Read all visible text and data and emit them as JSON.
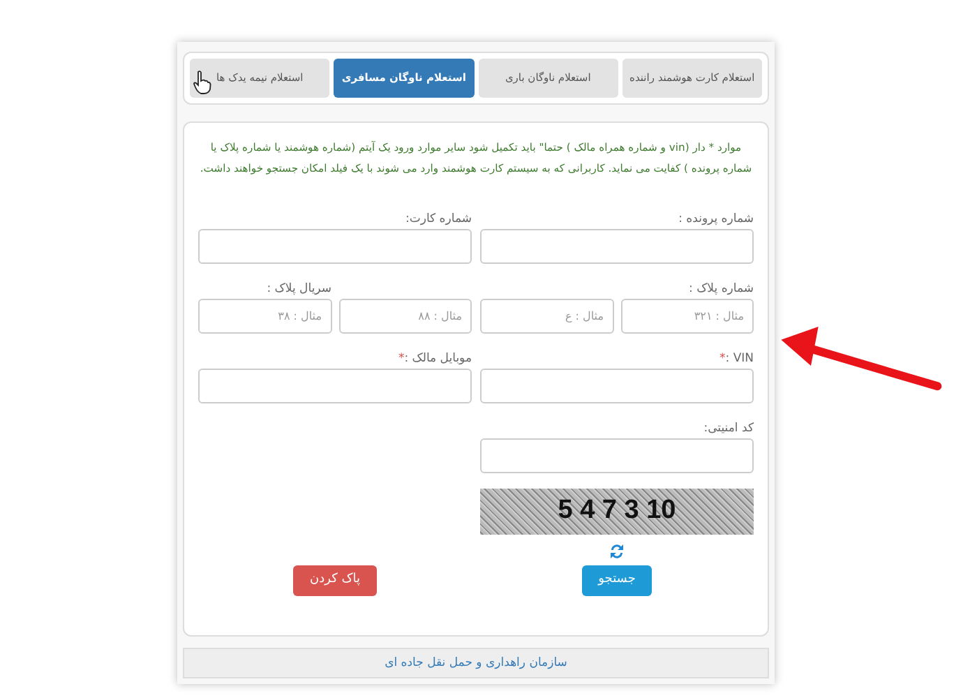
{
  "tabs": [
    {
      "label": "استعلام کارت هوشمند راننده",
      "selected": false
    },
    {
      "label": "استعلام ناوگان باری",
      "selected": false
    },
    {
      "label": "استعلام ناوگان مسافری",
      "selected": true
    },
    {
      "label": "استعلام نیمه یدک ها",
      "selected": false
    }
  ],
  "notice": "موارد * دار (vin و شماره همراه مالک ) حتما\" باید تکمیل شود سایر موارد ورود یک آیتم (شماره هوشمند یا شماره پلاک یا شماره پرونده ) کفایت می نماید. کاربرانی که به سیستم کارت هوشمند وارد می شوند با یک فیلد امکان جستجو خواهند داشت.",
  "rows": [
    {
      "kind": "pair",
      "fields": [
        {
          "label": "شماره پرونده :"
        },
        {
          "label": "شماره کارت:"
        }
      ]
    },
    {
      "kind": "plate",
      "fields": [
        {
          "label": "شماره پلاک :",
          "placeholder": "مثال : ۳۲۱"
        },
        {
          "placeholder": "مثال : ع"
        },
        {
          "placeholder": "مثال : ۸۸"
        },
        {
          "label": "سریال پلاک :",
          "placeholder": "مثال : ۳۸"
        }
      ]
    },
    {
      "kind": "pair",
      "fields": [
        {
          "label": "VIN :",
          "required_mark": "*"
        },
        {
          "label": "موبایل مالک :",
          "required_mark": "*"
        }
      ]
    },
    {
      "kind": "single",
      "fields": [
        {
          "label": "کد امنیتی:"
        }
      ]
    }
  ],
  "captcha": "5 4 7 3 10",
  "buttons": [
    {
      "label": "جستجو",
      "kind": "primary"
    },
    {
      "label": "پاک کردن",
      "kind": "danger"
    }
  ],
  "footer": "سازمان راهداری و حمل نقل جاده ای"
}
